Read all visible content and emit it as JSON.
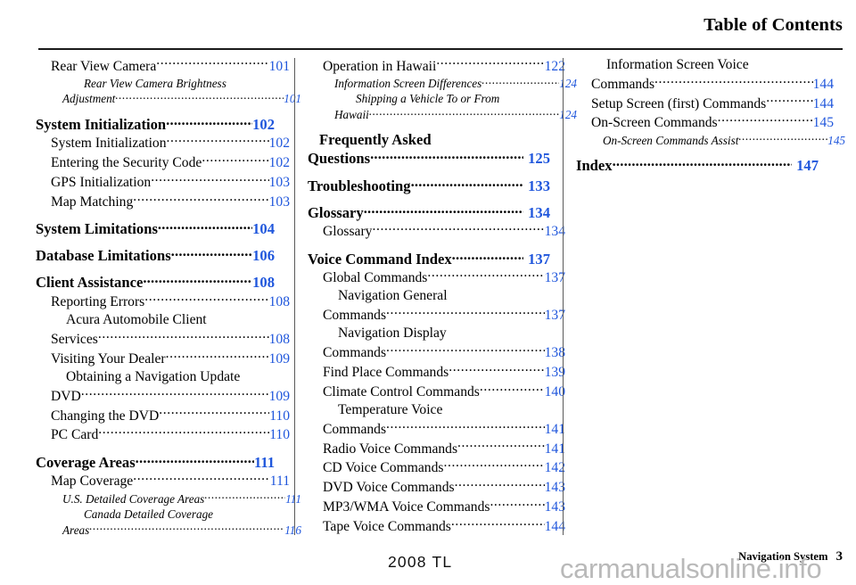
{
  "header": {
    "title": "Table of Contents"
  },
  "footer": {
    "model_year": "2008  TL",
    "section_label": "Navigation System",
    "page_number": "3",
    "watermark": "carmanualsonline.info"
  },
  "colors": {
    "page_number_blue": "#1f56dc",
    "text_black": "#000000",
    "watermark_gray": "#b9b9b9",
    "rule_dark": "#1a1a1a",
    "divider_gray": "#5a5a5a"
  },
  "columns": [
    {
      "id": "column-1",
      "entries": [
        {
          "level": 2,
          "lines": [
            "Rear View Camera"
          ],
          "page": "101"
        },
        {
          "level": 3,
          "lines": [
            "Rear View Camera Brightness",
            "Adjustment"
          ],
          "page": "101"
        },
        {
          "level": 1,
          "lines": [
            "System Initialization"
          ],
          "page": "102"
        },
        {
          "level": 2,
          "lines": [
            "System Initialization"
          ],
          "page": "102"
        },
        {
          "level": 2,
          "lines": [
            "Entering the Security Code"
          ],
          "page": "102"
        },
        {
          "level": 2,
          "lines": [
            "GPS Initialization"
          ],
          "page": "103"
        },
        {
          "level": 2,
          "lines": [
            "Map Matching"
          ],
          "page": "103"
        },
        {
          "level": 1,
          "lines": [
            "System Limitations"
          ],
          "page": "104"
        },
        {
          "level": 1,
          "lines": [
            "Database Limitations"
          ],
          "page": "106"
        },
        {
          "level": 1,
          "lines": [
            "Client Assistance"
          ],
          "page": "108"
        },
        {
          "level": 2,
          "lines": [
            "Reporting Errors"
          ],
          "page": "108"
        },
        {
          "level": 2,
          "lines": [
            "Acura Automobile Client",
            "Services"
          ],
          "page": "108"
        },
        {
          "level": 2,
          "lines": [
            "Visiting Your Dealer"
          ],
          "page": "109"
        },
        {
          "level": 2,
          "lines": [
            "Obtaining a Navigation Update",
            "DVD"
          ],
          "page": "109"
        },
        {
          "level": 2,
          "lines": [
            "Changing the DVD"
          ],
          "page": "110"
        },
        {
          "level": 2,
          "lines": [
            "PC Card"
          ],
          "page": "110"
        },
        {
          "level": 1,
          "lines": [
            "Coverage Areas"
          ],
          "page": "111"
        },
        {
          "level": 2,
          "lines": [
            "Map Coverage"
          ],
          "page": "111"
        },
        {
          "level": 3,
          "lines": [
            "U.S. Detailed Coverage Areas"
          ],
          "page": "111"
        },
        {
          "level": 3,
          "lines": [
            "Canada Detailed Coverage",
            "Areas"
          ],
          "page": "116"
        }
      ]
    },
    {
      "id": "column-2",
      "entries": [
        {
          "level": 2,
          "lines": [
            "Operation in Hawaii"
          ],
          "page": "122"
        },
        {
          "level": 3,
          "lines": [
            "Information Screen Differences"
          ],
          "page": "124"
        },
        {
          "level": 3,
          "lines": [
            "Shipping a Vehicle To or From",
            "Hawaii"
          ],
          "page": "124"
        },
        {
          "level": 1,
          "lines": [
            "Frequently Asked",
            "Questions"
          ],
          "page": "125",
          "space_before_page": true
        },
        {
          "level": 1,
          "lines": [
            "Troubleshooting"
          ],
          "page": "133",
          "space_before_page": true
        },
        {
          "level": 1,
          "lines": [
            "Glossary"
          ],
          "page": "134",
          "space_before_page": true
        },
        {
          "level": 2,
          "lines": [
            "Glossary"
          ],
          "page": "134"
        },
        {
          "level": 1,
          "lines": [
            "Voice Command Index"
          ],
          "page": "137",
          "space_before_page": true
        },
        {
          "level": 2,
          "lines": [
            "Global Commands"
          ],
          "page": "137"
        },
        {
          "level": 2,
          "lines": [
            "Navigation General",
            "Commands"
          ],
          "page": "137"
        },
        {
          "level": 2,
          "lines": [
            "Navigation Display",
            "Commands"
          ],
          "page": "138"
        },
        {
          "level": 2,
          "lines": [
            "Find Place Commands"
          ],
          "page": "139"
        },
        {
          "level": 2,
          "lines": [
            "Climate Control Commands"
          ],
          "page": "140"
        },
        {
          "level": 2,
          "lines": [
            "Temperature Voice",
            "Commands"
          ],
          "page": "141"
        },
        {
          "level": 2,
          "lines": [
            "Radio Voice Commands"
          ],
          "page": "141"
        },
        {
          "level": 2,
          "lines": [
            "CD Voice Commands"
          ],
          "page": "142"
        },
        {
          "level": 2,
          "lines": [
            "DVD Voice Commands"
          ],
          "page": "143"
        },
        {
          "level": 2,
          "lines": [
            "MP3/WMA Voice Commands"
          ],
          "page": "143"
        },
        {
          "level": 2,
          "lines": [
            "Tape Voice Commands"
          ],
          "page": "144"
        }
      ]
    },
    {
      "id": "column-3",
      "entries": [
        {
          "level": 2,
          "lines": [
            "Information Screen Voice",
            "Commands"
          ],
          "page": "144"
        },
        {
          "level": 2,
          "lines": [
            "Setup Screen (first) Commands"
          ],
          "page": "144"
        },
        {
          "level": 2,
          "lines": [
            "On-Screen Commands"
          ],
          "page": "145"
        },
        {
          "level": 3,
          "lines": [
            "On-Screen Commands Assist"
          ],
          "page": "145"
        },
        {
          "level": 1,
          "lines": [
            "Index"
          ],
          "page": "147",
          "space_before_page": true
        }
      ]
    }
  ]
}
